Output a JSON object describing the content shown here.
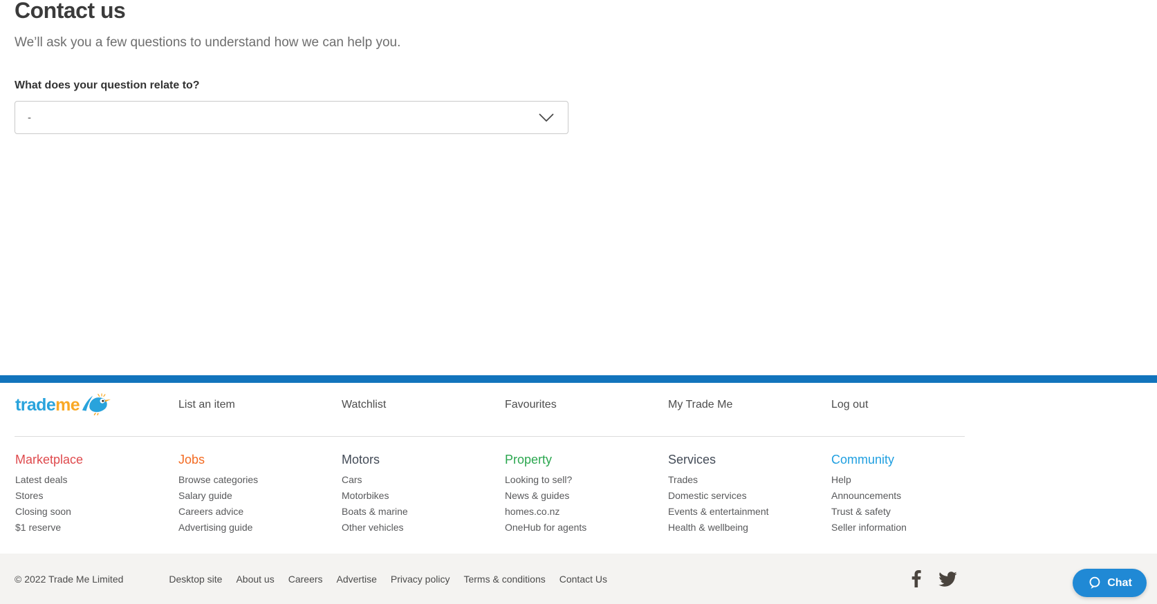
{
  "page": {
    "title": "Contact us",
    "subtitle": "We’ll ask you a few questions to understand how we can help you.",
    "form": {
      "question_label": "What does your question relate to?",
      "select_value": "-"
    }
  },
  "footer": {
    "logo": {
      "trade": "trade",
      "me": "me",
      "trade_color": "#29a3dc",
      "me_color": "#f9a825"
    },
    "nav": [
      "List an item",
      "Watchlist",
      "Favourites",
      "My Trade Me",
      "Log out"
    ],
    "columns": [
      {
        "heading": "Marketplace",
        "color": "#df4a4d",
        "links": [
          "Latest deals",
          "Stores",
          "Closing soon",
          "$1 reserve"
        ]
      },
      {
        "heading": "Jobs",
        "color": "#f36a21",
        "links": [
          "Browse categories",
          "Salary guide",
          "Careers advice",
          "Advertising guide"
        ]
      },
      {
        "heading": "Motors",
        "color": "#434b57",
        "links": [
          "Cars",
          "Motorbikes",
          "Boats & marine",
          "Other vehicles"
        ]
      },
      {
        "heading": "Property",
        "color": "#2ca750",
        "links": [
          "Looking to sell?",
          "News & guides",
          "homes.co.nz",
          "OneHub for agents"
        ]
      },
      {
        "heading": "Services",
        "color": "#434b57",
        "links": [
          "Trades",
          "Domestic services",
          "Events & entertainment",
          "Health & wellbeing"
        ]
      },
      {
        "heading": "Community",
        "color": "#1f9fe0",
        "links": [
          "Help",
          "Announcements",
          "Trust & safety",
          "Seller information"
        ]
      }
    ],
    "bottom": {
      "copyright": "© 2022 Trade Me Limited",
      "links": [
        "Desktop site",
        "About us",
        "Careers",
        "Advertise",
        "Privacy policy",
        "Terms & conditions",
        "Contact Us"
      ],
      "chat_label": "Chat"
    },
    "colors": {
      "accent_bar": "#1274bc",
      "chat_button": "#2089d5",
      "social_icon": "#4a443e"
    }
  }
}
